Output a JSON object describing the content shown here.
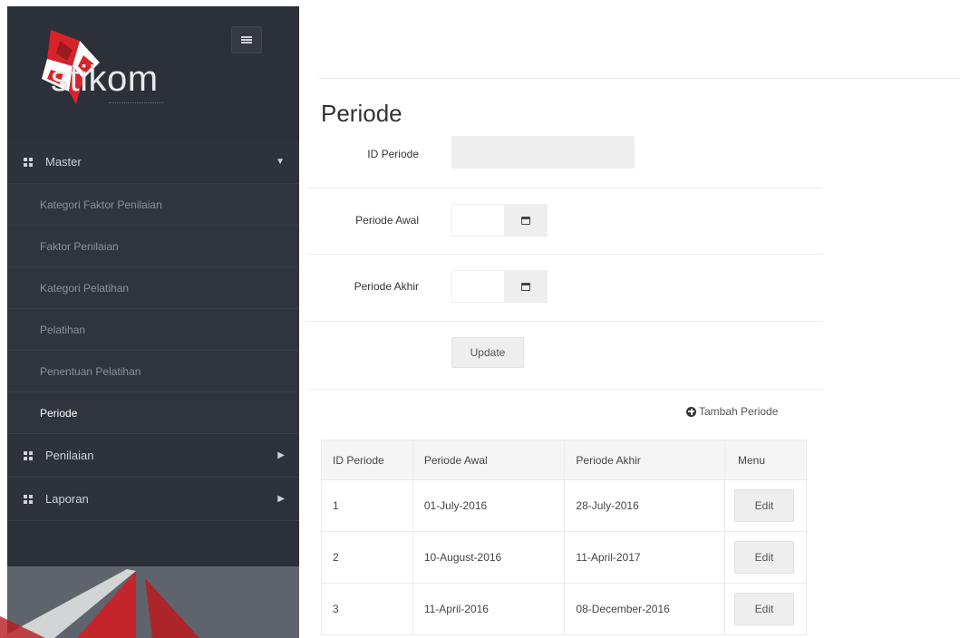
{
  "sidebar": {
    "logo_text": "stikom",
    "menu": [
      {
        "label": "Master",
        "expanded": true,
        "items": [
          {
            "label": "Kategori Faktor Penilaian"
          },
          {
            "label": "Faktor Penilaian"
          },
          {
            "label": "Kategori Pelatihan"
          },
          {
            "label": "Pelatihan"
          },
          {
            "label": "Penentuan Pelatihan"
          },
          {
            "label": "Periode",
            "active": true
          }
        ]
      },
      {
        "label": "Penilaian",
        "expanded": false
      },
      {
        "label": "Laporan",
        "expanded": false
      }
    ]
  },
  "main": {
    "title": "Periode",
    "form": {
      "id_label": "ID Periode",
      "id_value": "",
      "awal_label": "Periode Awal",
      "akhir_label": "Periode Akhir",
      "update_label": "Update"
    },
    "add_label": "Tambah Periode",
    "table": {
      "headers": [
        "ID Periode",
        "Periode Awal",
        "Periode Akhir",
        "Menu"
      ],
      "rows": [
        {
          "id": "1",
          "awal": "01-July-2016",
          "akhir": "28-July-2016",
          "action": "Edit"
        },
        {
          "id": "2",
          "awal": "10-August-2016",
          "akhir": "11-April-2017",
          "action": "Edit"
        },
        {
          "id": "3",
          "awal": "11-April-2016",
          "akhir": "08-December-2016",
          "action": "Edit"
        }
      ]
    }
  },
  "colors": {
    "sidebar_bg": "#2b3039",
    "logo_red": "#d8232a"
  }
}
